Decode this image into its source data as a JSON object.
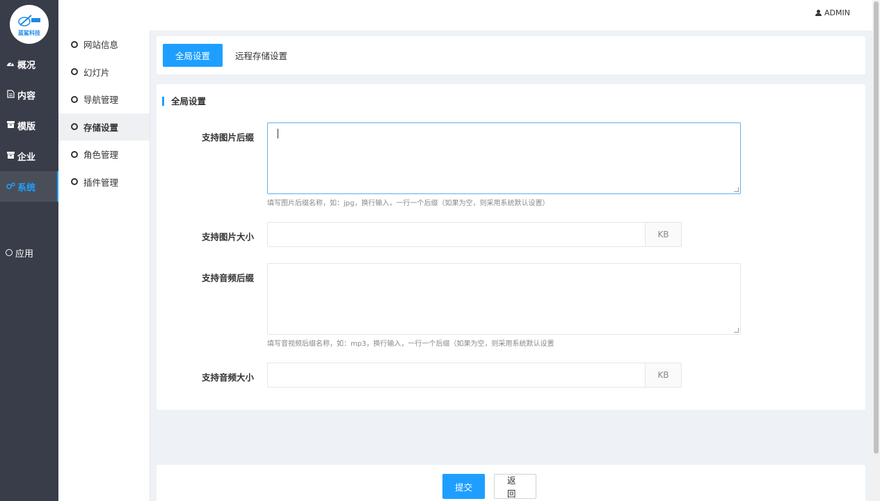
{
  "brand": {
    "name": "蓝鲨科技",
    "logo_icon": "company-logo"
  },
  "main_nav": {
    "items": [
      {
        "label": "概况",
        "icon": "dashboard-icon"
      },
      {
        "label": "内容",
        "icon": "document-icon"
      },
      {
        "label": "模版",
        "icon": "box-icon"
      },
      {
        "label": "企业",
        "icon": "box-icon"
      },
      {
        "label": "系统",
        "icon": "gears-icon",
        "active": true
      }
    ],
    "app_label": "应用"
  },
  "sub_nav": {
    "items": [
      {
        "label": "网站信息"
      },
      {
        "label": "幻灯片"
      },
      {
        "label": "导航管理"
      },
      {
        "label": "存储设置",
        "active": true
      },
      {
        "label": "角色管理"
      },
      {
        "label": "插件管理"
      }
    ]
  },
  "header": {
    "user_label": "ADMIN",
    "user_icon": "user-icon"
  },
  "tabs": [
    {
      "label": "全局设置",
      "active": true
    },
    {
      "label": "远程存储设置"
    }
  ],
  "form": {
    "section_title": "全局设置",
    "image_suffix": {
      "label": "支持图片后缀",
      "value": "",
      "hint": "填写图片后缀名称，如：jpg，换行输入，一行一个后缀（如果为空，则采用系统默认设置）"
    },
    "image_size": {
      "label": "支持图片大小",
      "value": "",
      "unit": "KB"
    },
    "audio_suffix": {
      "label": "支持音频后缀",
      "value": "",
      "hint": "填写音视频后缀名称，如：mp3，换行输入，一行一个后缀（如果为空，则采用系统默认设置"
    },
    "audio_size": {
      "label": "支持音频大小",
      "value": "",
      "unit": "KB"
    }
  },
  "actions": {
    "submit_label": "提交",
    "back_label": "返回"
  },
  "colors": {
    "accent": "#1e9fff",
    "sidebar_bg": "#393d49",
    "page_bg": "#eef1f5"
  }
}
